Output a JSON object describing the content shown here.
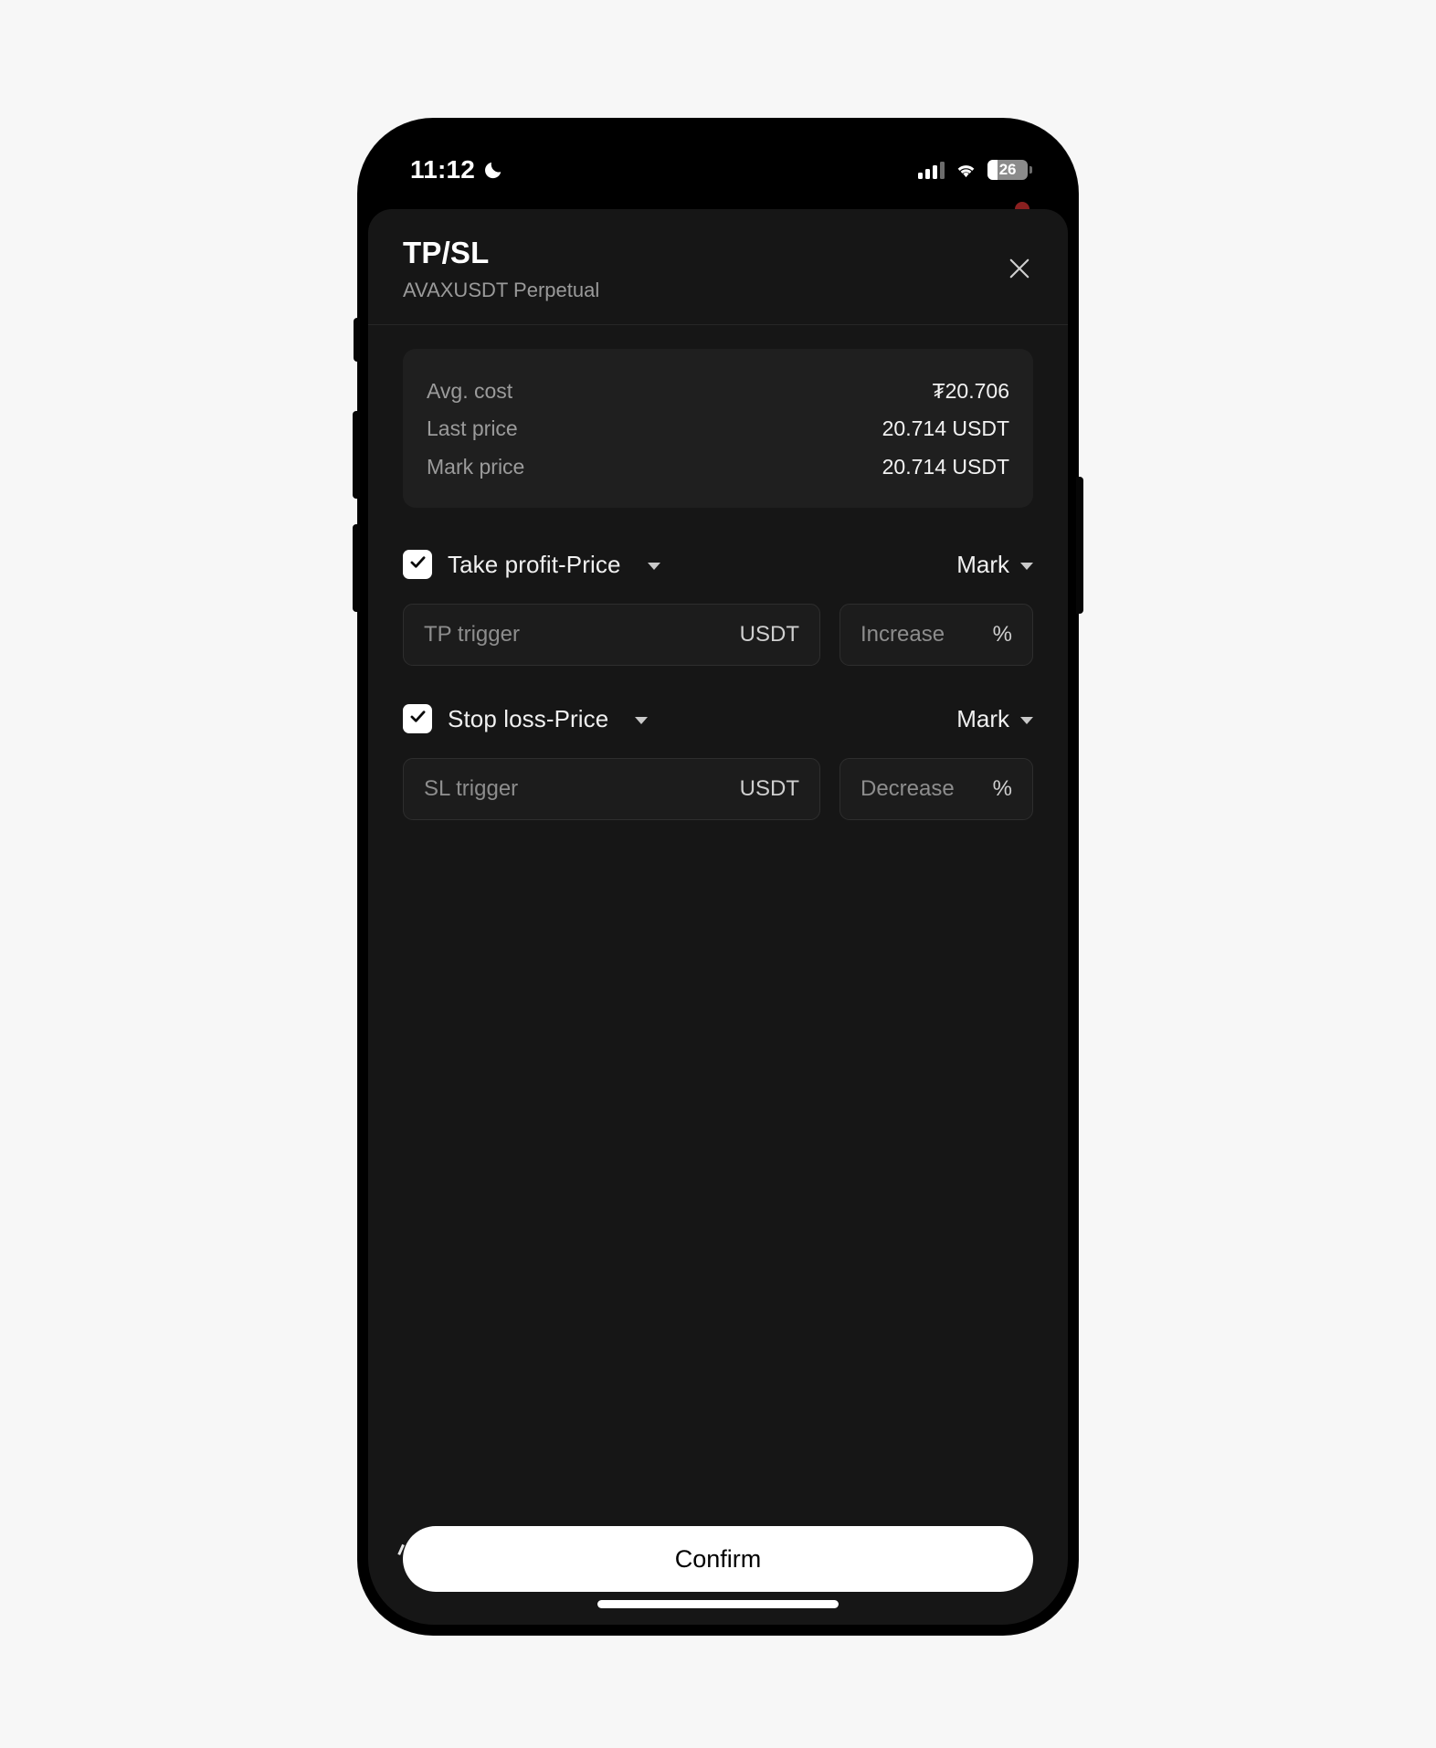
{
  "status_bar": {
    "time": "11:12",
    "dnd_icon": "crescent-moon-icon",
    "signal_icon": "cellular-signal-icon",
    "signal_bars_filled": 3,
    "signal_bars_total": 4,
    "wifi_icon": "wifi-icon",
    "battery_icon": "battery-icon",
    "battery_level": "26",
    "battery_percent": 26
  },
  "sheet": {
    "title": "TP/SL",
    "subtitle": "AVAXUSDT Perpetual",
    "close_icon": "close-icon"
  },
  "price_card": {
    "rows": [
      {
        "label": "Avg. cost",
        "value": "₮20.706"
      },
      {
        "label": "Last price",
        "value": "20.714 USDT"
      },
      {
        "label": "Mark price",
        "value": "20.714 USDT"
      }
    ]
  },
  "take_profit": {
    "checked": true,
    "check_icon": "checkmark-icon",
    "label": "Take profit-Price",
    "label_caret_icon": "chevron-down-icon",
    "trigger_source": "Mark",
    "source_caret_icon": "chevron-down-icon",
    "trigger_field": {
      "value": "",
      "placeholder": "TP trigger",
      "suffix": "USDT"
    },
    "percent_field": {
      "value": "",
      "placeholder": "Increase",
      "suffix": "%"
    }
  },
  "stop_loss": {
    "checked": true,
    "check_icon": "checkmark-icon",
    "label": "Stop loss-Price",
    "label_caret_icon": "chevron-down-icon",
    "trigger_source": "Mark",
    "source_caret_icon": "chevron-down-icon",
    "trigger_field": {
      "value": "",
      "placeholder": "SL trigger",
      "suffix": "USDT"
    },
    "percent_field": {
      "value": "",
      "placeholder": "Decrease",
      "suffix": "%"
    }
  },
  "footer": {
    "confirm_label": "Confirm"
  },
  "colors": {
    "page_background": "#f7f7f7",
    "screen_background": "#000000",
    "sheet_background": "#161616",
    "card_background": "#1f1f1f",
    "field_background": "#1c1c1c",
    "field_border": "#2e2e2e",
    "primary_text": "#ffffff",
    "secondary_text": "#9a9a9a",
    "accent": "#ffffff",
    "confirm_text": "#000000",
    "notification_dot": "#8a2020"
  }
}
